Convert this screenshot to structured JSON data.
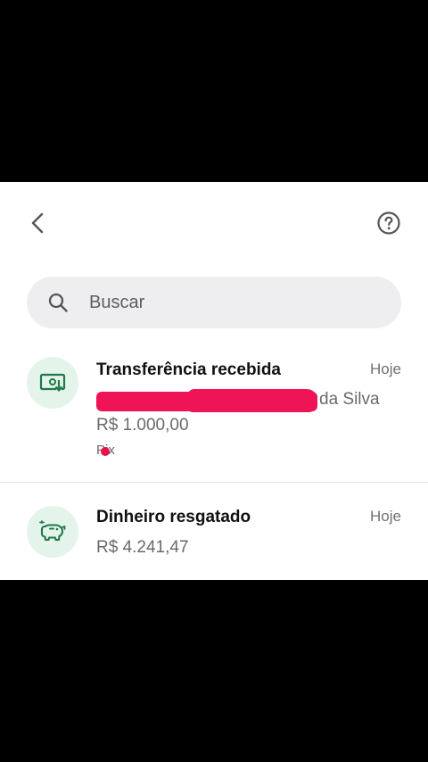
{
  "header": {
    "back_icon": "chevron-left-icon",
    "help_icon": "help-circle-icon"
  },
  "search": {
    "placeholder": "Buscar",
    "icon": "search-icon"
  },
  "transactions": [
    {
      "title": "Transferência recebida",
      "date": "Hoje",
      "counterparty_visible": "da Silva",
      "amount": "R$ 1.000,00",
      "method": "Pix",
      "icon": "money-receive-icon"
    },
    {
      "title": "Dinheiro resgatado",
      "date": "Hoje",
      "amount": "R$ 4.241,47",
      "icon": "piggy-bank-icon"
    }
  ],
  "colors": {
    "accent_green": "#1e7a4b",
    "avatar_bg": "#e4f4ea",
    "redaction": "#ee1456"
  }
}
